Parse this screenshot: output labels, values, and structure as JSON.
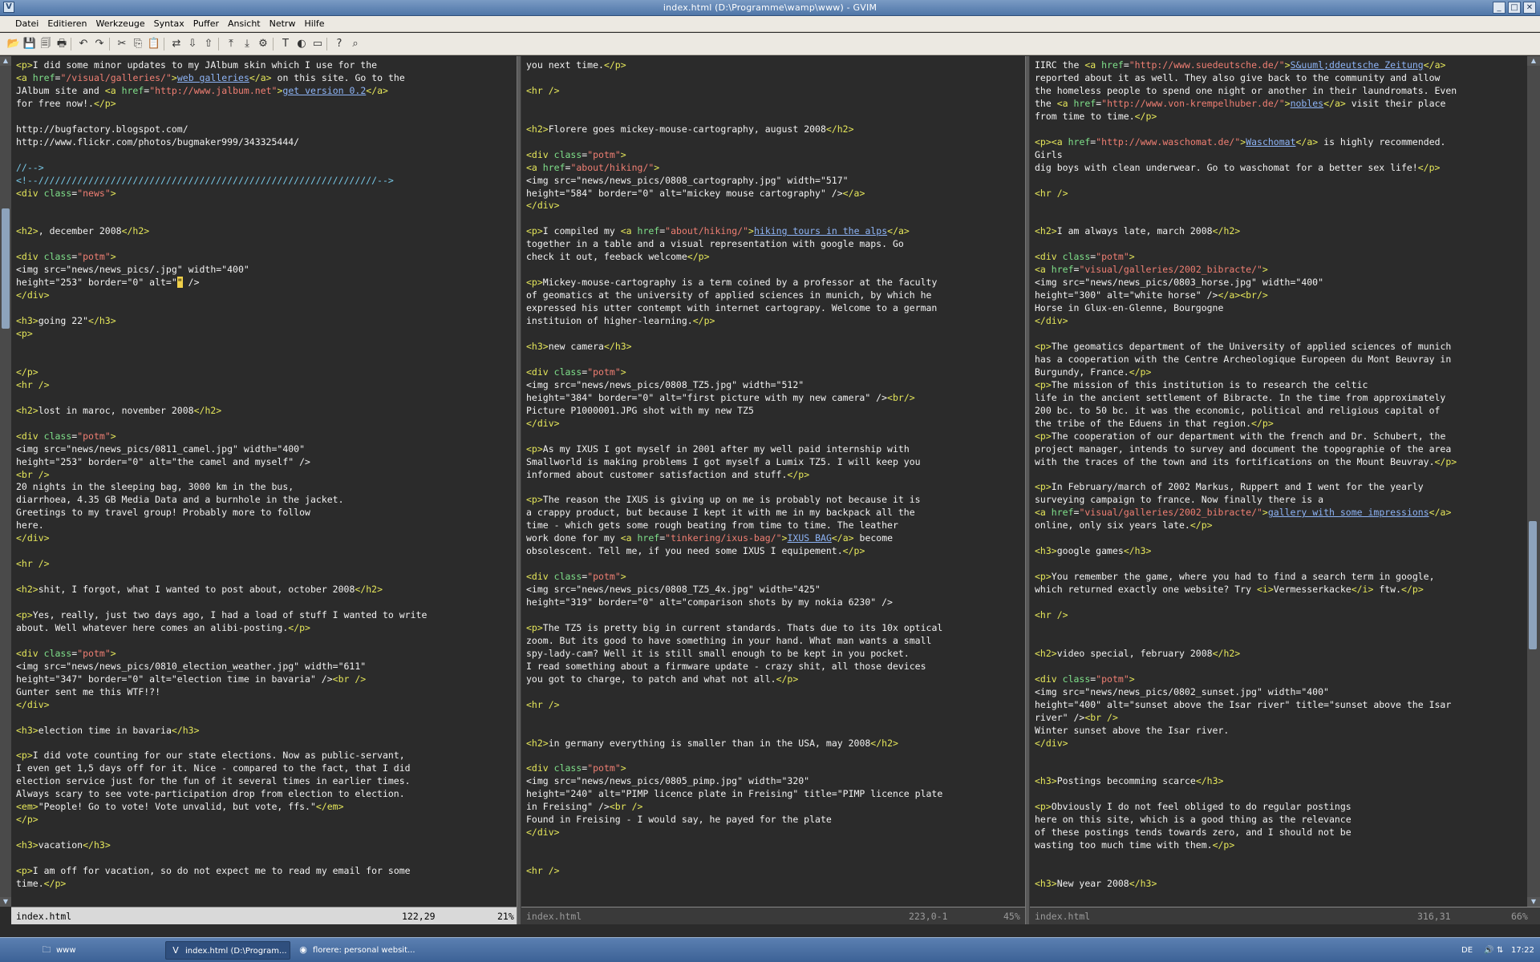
{
  "window": {
    "title": "index.html (D:\\Programme\\wamp\\www) - GVIM",
    "buttons": [
      "_",
      "□",
      "✕"
    ]
  },
  "menu": [
    "Datei",
    "Editieren",
    "Werkzeuge",
    "Syntax",
    "Puffer",
    "Ansicht",
    "Netrw",
    "Hilfe"
  ],
  "toolbar_icons": [
    {
      "name": "open-icon",
      "glyph": "📂"
    },
    {
      "name": "save-icon",
      "glyph": "💾"
    },
    {
      "name": "save-all-icon",
      "glyph": "🗐"
    },
    {
      "name": "print-icon",
      "glyph": "🖶"
    },
    {
      "name": "undo-icon",
      "glyph": "↶"
    },
    {
      "name": "redo-icon",
      "glyph": "↷"
    },
    {
      "name": "cut-icon",
      "glyph": "✂"
    },
    {
      "name": "copy-icon",
      "glyph": "⎘"
    },
    {
      "name": "paste-icon",
      "glyph": "📋"
    },
    {
      "name": "find-replace-icon",
      "glyph": "⇄"
    },
    {
      "name": "find-next-icon",
      "glyph": "⇩"
    },
    {
      "name": "find-prev-icon",
      "glyph": "⇧"
    },
    {
      "name": "load-session-icon",
      "glyph": "⤒"
    },
    {
      "name": "save-session-icon",
      "glyph": "⤓"
    },
    {
      "name": "run-script-icon",
      "glyph": "⚙"
    },
    {
      "name": "make-icon",
      "glyph": "T"
    },
    {
      "name": "tags-icon",
      "glyph": "◐"
    },
    {
      "name": "shell-icon",
      "glyph": "▭"
    },
    {
      "name": "help-icon",
      "glyph": "?"
    },
    {
      "name": "find-help-icon",
      "glyph": "⌕"
    }
  ],
  "panes": [
    {
      "lines": [
        "<p>I did some minor updates to my JAlbum skin which I use for the",
        "<a href=\"/visual/galleries/\">web galleries</a> on this site. Go to the",
        "JAlbum site and <a href=\"http://www.jalbum.net\">get version 0.2</a>",
        "for free now!.</p>",
        "",
        "http://bugfactory.blogspot.com/",
        "http://www.flickr.com/photos/bugmaker999/343325444/",
        "",
        "//-->",
        "<!--/////////////////////////////////////////////////////////////-->",
        "<div class=\"news\">",
        "",
        "",
        "<h2>, december 2008</h2>",
        "",
        "<div class=\"potm\">",
        "<img src=\"news/news_pics/.jpg\" width=\"400\"",
        "height=\"253\" border=\"0\" alt=\"\" />",
        "</div>",
        "",
        "<h3>going 22\"</h3>",
        "<p>",
        "",
        "",
        "</p>",
        "<hr />",
        "",
        "<h2>lost in maroc, november 2008</h2>",
        "",
        "<div class=\"potm\">",
        "<img src=\"news/news_pics/0811_camel.jpg\" width=\"400\"",
        "height=\"253\" border=\"0\" alt=\"the camel and myself\" />",
        "<br />",
        "20 nights in the sleeping bag, 3000 km in the bus,",
        "diarrhoea, 4.35 GB Media Data and a burnhole in the jacket.",
        "Greetings to my travel group! Probably more to follow",
        "here.",
        "</div>",
        "",
        "<hr />",
        "",
        "<h2>shit, I forgot, what I wanted to post about, october 2008</h2>",
        "",
        "<p>Yes, really, just two days ago, I had a load of stuff I wanted to write",
        "about. Well whatever here comes an alibi-posting.</p>",
        "",
        "<div class=\"potm\">",
        "<img src=\"news/news_pics/0810_election_weather.jpg\" width=\"611\"",
        "height=\"347\" border=\"0\" alt=\"election time in bavaria\" /><br />",
        "Gunter sent me this WTF!?!",
        "</div>",
        "",
        "<h3>election time in bavaria</h3>",
        "",
        "<p>I did vote counting for our state elections. Now as public-servant,",
        "I even get 1,5 days off for it. Nice - compared to the fact, that I did",
        "election service just for the fun of it several times in earlier times.",
        "Always scary to see vote-participation drop from election to election.",
        "<em>\"People! Go to vote! Vote unvalid, but vote, ffs.\"</em>",
        "</p>",
        "",
        "<h3>vacation</h3>",
        "",
        "<p>I am off for vacation, so do not expect me to read my email for some",
        "time.</p>"
      ],
      "status": {
        "file": "index.html",
        "position": "122,29",
        "percent": "21%"
      }
    },
    {
      "lines": [
        "you next time.</p>",
        "",
        "<hr />",
        "",
        "",
        "<h2>Florere goes mickey-mouse-cartography, august 2008</h2>",
        "",
        "<div class=\"potm\">",
        "<a href=\"about/hiking/\">",
        "<img src=\"news/news_pics/0808_cartography.jpg\" width=\"517\"",
        "height=\"584\" border=\"0\" alt=\"mickey mouse cartography\" /></a>",
        "</div>",
        "",
        "<p>I compiled my <a href=\"about/hiking/\">hiking tours in the alps</a>",
        "together in a table and a visual representation with google maps. Go",
        "check it out, feeback welcome</p>",
        "",
        "<p>Mickey-mouse-cartography is a term coined by a professor at the faculty",
        "of geomatics at the university of applied sciences in munich, by which he",
        "expressed his utter contempt with internet cartograpy. Welcome to a german",
        "instituion of higher-learning.</p>",
        "",
        "<h3>new camera</h3>",
        "",
        "<div class=\"potm\">",
        "<img src=\"news/news_pics/0808_TZ5.jpg\" width=\"512\"",
        "height=\"384\" border=\"0\" alt=\"first picture with my new camera\" /><br/>",
        "Picture P1000001.JPG shot with my new TZ5",
        "</div>",
        "",
        "<p>As my IXUS I got myself in 2001 after my well paid internship with",
        "Smallworld is making problems I got myself a Lumix TZ5. I will keep you",
        "informed about customer satisfaction and stuff.</p>",
        "",
        "<p>The reason the IXUS is giving up on me is probably not because it is",
        "a crappy product, but because I kept it with me in my backpack all the",
        "time - which gets some rough beating from time to time. The leather",
        "work done for my <a href=\"tinkering/ixus-bag/\">IXUS BAG</a> become",
        "obsolescent. Tell me, if you need some IXUS I equipement.</p>",
        "",
        "<div class=\"potm\">",
        "<img src=\"news/news_pics/0808_TZ5_4x.jpg\" width=\"425\"",
        "height=\"319\" border=\"0\" alt=\"comparison shots by my nokia 6230\" />",
        "",
        "<p>The TZ5 is pretty big in current standards. Thats due to its 10x optical",
        "zoom. But its good to have something in your hand. What man wants a small",
        "spy-lady-cam? Well it is still small enough to be kept in you pocket.",
        "I read something about a firmware update - crazy shit, all those devices",
        "you got to charge, to patch and what not all.</p>",
        "",
        "<hr />",
        "",
        "",
        "<h2>in germany everything is smaller than in the USA, may 2008</h2>",
        "",
        "<div class=\"potm\">",
        "<img src=\"news/news_pics/0805_pimp.jpg\" width=\"320\"",
        "height=\"240\" alt=\"PIMP licence plate in Freising\" title=\"PIMP licence plate",
        "in Freising\" /><br />",
        "Found in Freising - I would say, he payed for the plate",
        "</div>",
        "",
        "",
        "<hr />"
      ],
      "status": {
        "file": "index.html",
        "position": "223,0-1",
        "percent": "45%"
      }
    },
    {
      "lines": [
        "IIRC the <a href=\"http://www.suedeutsche.de/\">S&uuml;ddeutsche Zeitung</a>",
        "reported about it as well. They also give back to the community and allow",
        "the homeless people to spend one night or another in their laundromats. Even",
        "the <a href=\"http://www.von-krempelhuber.de/\">nobles</a> visit their place",
        "from time to time.</p>",
        "",
        "<p><a href=\"http://www.waschomat.de/\">Waschomat</a> is highly recommended.",
        "Girls",
        "dig boys with clean underwear. Go to waschomat for a better sex life!</p>",
        "",
        "<hr />",
        "",
        "",
        "<h2>I am always late, march 2008</h2>",
        "",
        "<div class=\"potm\">",
        "<a href=\"visual/galleries/2002_bibracte/\">",
        "<img src=\"news/news_pics/0803_horse.jpg\" width=\"400\"",
        "height=\"300\" alt=\"white horse\" /></a><br/>",
        "Horse in Glux-en-Glenne, Bourgogne",
        "</div>",
        "",
        "<p>The geomatics department of the University of applied sciences of munich",
        "has a cooperation with the Centre Archeologique Europeen du Mont Beuvray in",
        "Burgundy, France.</p>",
        "<p>The mission of this institution is to research the celtic",
        "life in the ancient settlement of Bibracte. In the time from approximately",
        "200 bc. to 50 bc. it was the economic, political and religious capital of",
        "the tribe of the Eduens in that region.</p>",
        "<p>The cooperation of our department with the french and Dr. Schubert, the",
        "project manager, intends to survey and document the topographie of the area",
        "with the traces of the town and its fortifications on the Mount Beuvray.</p>",
        "",
        "<p>In February/march of 2002 Markus, Ruppert and I went for the yearly",
        "surveying campaign to france. Now finally there is a",
        "<a href=\"visual/galleries/2002_bibracte/\">gallery with some impressions</a>",
        "online, only six years late.</p>",
        "",
        "<h3>google games</h3>",
        "",
        "<p>You remember the game, where you had to find a search term in google,",
        "which returned exactly one website? Try <i>Vermesserkacke</i> ftw.</p>",
        "",
        "<hr />",
        "",
        "",
        "<h2>video special, february 2008</h2>",
        "",
        "<div class=\"potm\">",
        "<img src=\"news/news_pics/0802_sunset.jpg\" width=\"400\"",
        "height=\"400\" alt=\"sunset above the Isar river\" title=\"sunset above the Isar",
        "river\" /><br />",
        "Winter sunset above the Isar river.",
        "</div>",
        "",
        "",
        "<h3>Postings becomming scarce</h3>",
        "",
        "<p>Obviously I do not feel obliged to do regular postings",
        "here on this site, which is a good thing as the relevance",
        "of these postings tends towards zero, and I should not be",
        "wasting too much time with them.</p>",
        "",
        "",
        "<h3>New year 2008</h3>"
      ],
      "status": {
        "file": "index.html",
        "position": "316,31",
        "percent": "66%"
      }
    }
  ],
  "cursor": {
    "pane": 0,
    "line": 17,
    "col": 29
  },
  "taskbar": {
    "items": [
      {
        "label": "www",
        "icon": "folder-icon"
      },
      {
        "label": "index.html (D:\\Program...",
        "icon": "gvim-icon",
        "active": true
      },
      {
        "label": "florere: personal websit...",
        "icon": "firefox-icon"
      }
    ],
    "language": "DE",
    "clock": "17:22"
  },
  "colors": {
    "background": "#2b2b2b",
    "tag": "#e6e75a",
    "attribute": "#7fe08a",
    "string": "#f07f73",
    "link": "#8eb4f6"
  }
}
